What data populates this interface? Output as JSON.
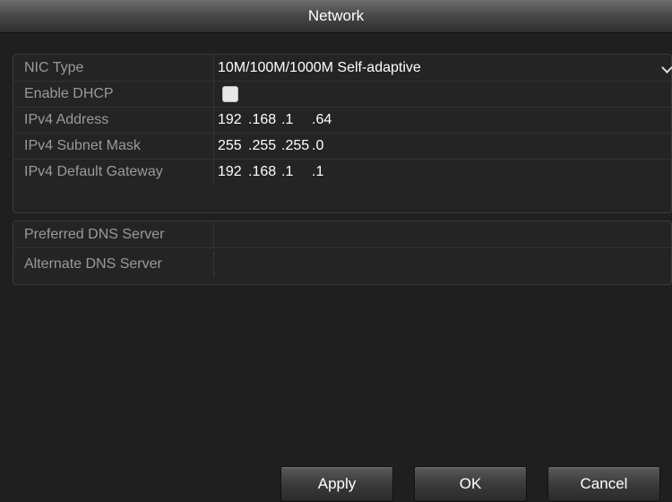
{
  "window": {
    "title": "Network"
  },
  "nic_group": {
    "nic_type": {
      "label": "NIC Type",
      "value": "10M/100M/1000M Self-adaptive"
    },
    "dhcp": {
      "label": "Enable DHCP",
      "checked": false
    },
    "ipv4_address": {
      "label": "IPv4 Address",
      "octets": [
        "192",
        ".168",
        ".1",
        ".64"
      ]
    },
    "subnet_mask": {
      "label": "IPv4 Subnet Mask",
      "octets": [
        "255",
        ".255",
        ".255",
        ".0"
      ]
    },
    "gateway": {
      "label": "IPv4 Default Gateway",
      "octets": [
        "192",
        ".168",
        ".1",
        ".1"
      ]
    }
  },
  "dns_group": {
    "preferred": {
      "label": "Preferred DNS Server",
      "value": ""
    },
    "alternate": {
      "label": "Alternate DNS Server",
      "value": ""
    }
  },
  "footer": {
    "apply_label": "Apply",
    "ok_label": "OK",
    "cancel_label": "Cancel"
  }
}
